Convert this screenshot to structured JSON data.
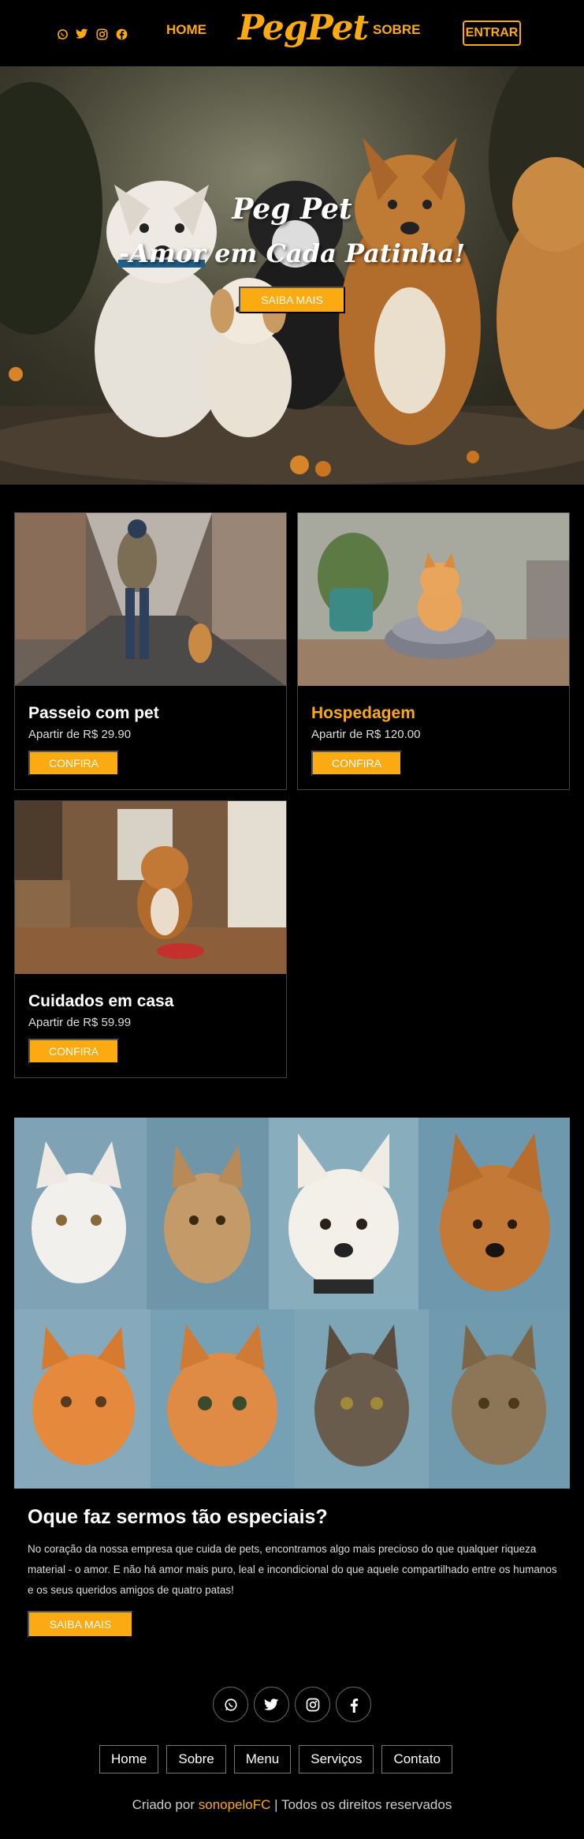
{
  "header": {
    "logo": "PegPet",
    "nav_home": "HOME",
    "nav_sobre": "SOBRE",
    "enter_label": "ENTRAR",
    "social_icons": [
      "whatsapp-icon",
      "twitter-icon",
      "instagram-icon",
      "facebook-icon"
    ]
  },
  "hero": {
    "title": "Peg Pet",
    "subtitle": "-Amor em Cada Patinha!",
    "button_label": "SAIBA MAIS"
  },
  "services": [
    {
      "title": "Passeio com pet",
      "price": "Apartir de R$ 29.90",
      "button": "CONFIRA"
    },
    {
      "title": "Hospedagem",
      "price": "Apartir de R$ 120.00",
      "button": "CONFIRA"
    },
    {
      "title": "Cuidados em casa",
      "price": "Apartir de R$ 59.99",
      "button": "CONFIRA"
    }
  ],
  "special": {
    "title": "Oque faz sermos tão especiais?",
    "text": "No coração da nossa empresa que cuida de pets, encontramos algo mais precioso do que qualquer riqueza material - o amor. E não há amor mais puro, leal e incondicional do que aquele compartilhado entre os humanos e os seus queridos amigos de quatro patas!",
    "button_label": "SAIBA MAIS"
  },
  "footer": {
    "social_icons": [
      "whatsapp-icon",
      "twitter-icon",
      "instagram-icon",
      "facebook-icon"
    ],
    "nav": [
      "Home",
      "Sobre",
      "Menu",
      "Serviços",
      "Contato"
    ],
    "credits_prefix": "Criado por ",
    "credits_author": "sonopeloFC",
    "credits_suffix": " | Todos os direitos reservados"
  },
  "colors": {
    "accent": "#fcaa12",
    "background": "#000000"
  }
}
